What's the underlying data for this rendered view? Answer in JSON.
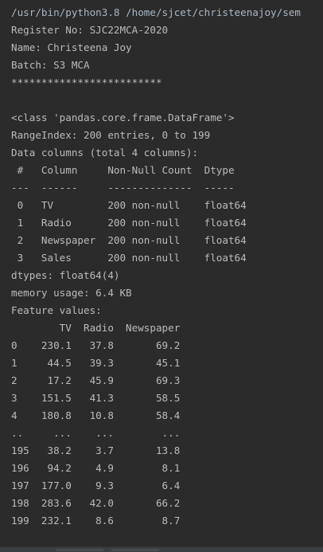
{
  "console": {
    "lines": [
      "/usr/bin/python3.8 /home/sjcet/christeenajoy/sem",
      "Register No: SJC22MCA-2020",
      "Name: Christeena Joy",
      "Batch: S3 MCA",
      "*************************",
      "",
      "<class 'pandas.core.frame.DataFrame'>",
      "RangeIndex: 200 entries, 0 to 199",
      "Data columns (total 4 columns):",
      " #   Column     Non-Null Count  Dtype",
      "---  ------     --------------  -----",
      " 0   TV         200 non-null    float64",
      " 1   Radio      200 non-null    float64",
      " 2   Newspaper  200 non-null    float64",
      " 3   Sales      200 non-null    float64",
      "dtypes: float64(4)",
      "memory usage: 6.4 KB",
      "Feature values:",
      "        TV  Radio  Newspaper",
      "0    230.1   37.8       69.2",
      "1     44.5   39.3       45.1",
      "2     17.2   45.9       69.3",
      "3    151.5   41.3       58.5",
      "4    180.8   10.8       58.4",
      "..     ...    ...        ...",
      "195   38.2    3.7       13.8",
      "196   94.2    4.9        8.1",
      "197  177.0    9.3        6.4",
      "198  283.6   42.0       66.2",
      "199  232.1    8.6        8.7"
    ]
  }
}
